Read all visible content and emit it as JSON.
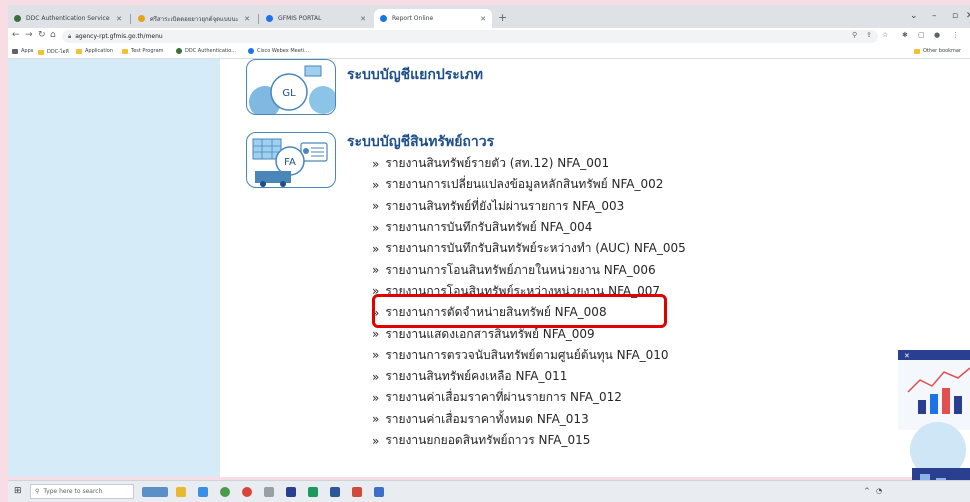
{
  "browser": {
    "tabs": [
      {
        "title": "DDC Authentication Services",
        "active": false,
        "color": "#3c6e3c"
      },
      {
        "title": "ศรีสาระเบิดดอยยาวยุกต์จุดแบบนะมดดก",
        "active": false,
        "color": "#e3a21a"
      },
      {
        "title": "GFMIS PORTAL",
        "active": false,
        "color": "#1a73e8"
      },
      {
        "title": "Report Online",
        "active": true,
        "color": "#1a73e8"
      }
    ],
    "url": "agency-rpt.gfmis.go.th/menu",
    "bookmarks": [
      "Apps",
      "DDC-ไอที",
      "Application",
      "Test Program",
      "DDC Authenticatio...",
      "Cisco Webex Meeti..."
    ],
    "other_bookmarks": "Other bookmar"
  },
  "sections": {
    "gl": {
      "icon_label": "GL",
      "title": "ระบบบัญชีแยกประเภท"
    },
    "fa": {
      "icon_label": "FA",
      "title": "ระบบบัญชีสินทรัพย์ถาวร"
    }
  },
  "report_marker": "»",
  "reports": [
    "รายงานสินทรัพย์รายตัว (สท.12) NFA_001",
    "รายงานการเปลี่ยนแปลงข้อมูลหลักสินทรัพย์ NFA_002",
    "รายงานสินทรัพย์ที่ยังไม่ผ่านรายการ NFA_003",
    "รายงานการบันทึกรับสินทรัพย์ NFA_004",
    "รายงานการบันทึกรับสินทรัพย์ระหว่างทำ (AUC) NFA_005",
    "รายงานการโอนสินทรัพย์ภายในหน่วยงาน NFA_006",
    "รายงานการโอนสินทรัพย์ระหว่างหน่วยงาน NFA_007",
    "รายงานการตัดจำหน่ายสินทรัพย์ NFA_008",
    "รายงานแสดงเอกสารสินทรัพย์ NFA_009",
    "รายงานการตรวจนับสินทรัพย์ตามศูนย์ต้นทุน NFA_010",
    "รายงานสินทรัพย์คงเหลือ NFA_011",
    "รายงานค่าเสื่อมราคาที่ผ่านรายการ NFA_012",
    "รายงานค่าเสื่อมราคาทั้งหมด NFA_013",
    "รายงานยกยอดสินทรัพย์ถาวร NFA_015"
  ],
  "highlighted_report": "NFA_008",
  "taskbar": {
    "search_placeholder": "Type here to search"
  },
  "colors": {
    "title": "#1e4e8c",
    "highlight": "#e00000",
    "sidebar": "#d6ebf8"
  }
}
